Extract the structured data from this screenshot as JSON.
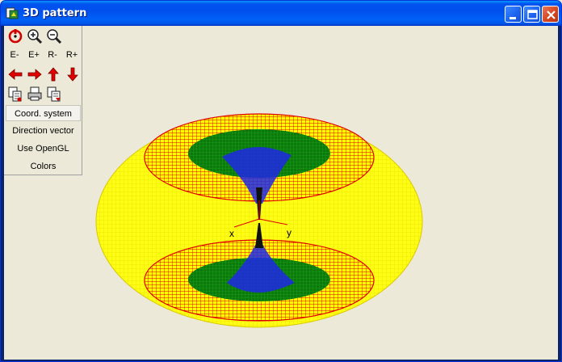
{
  "window": {
    "title": "3D pattern",
    "icon": "app-icon"
  },
  "titlebar_buttons": [
    "minimize-icon",
    "maximize-icon",
    "close-icon"
  ],
  "toolbar": {
    "row1": [
      {
        "name": "rotate-reset-icon",
        "color": "#D00000"
      },
      {
        "name": "zoom-in-icon"
      },
      {
        "name": "zoom-out-icon"
      }
    ],
    "row2": [
      "E-",
      "E+",
      "R-",
      "R+"
    ],
    "row3": [
      "arrow-left-icon",
      "arrow-right-icon",
      "arrow-up-icon",
      "arrow-down-icon"
    ],
    "row4": [
      "copy-image-icon",
      "print-icon",
      "save-image-icon"
    ]
  },
  "menu": {
    "items": [
      "Coord. system",
      "Direction vector",
      "Use OpenGL",
      "Colors"
    ],
    "active_index": 0
  },
  "plot": {
    "axes": {
      "x": "x",
      "y": "y"
    },
    "colors": {
      "outer": "#FFFF00",
      "ring": "#FF0000",
      "middle": "#008000",
      "inner": "#0000FF",
      "core": "#000000"
    }
  }
}
